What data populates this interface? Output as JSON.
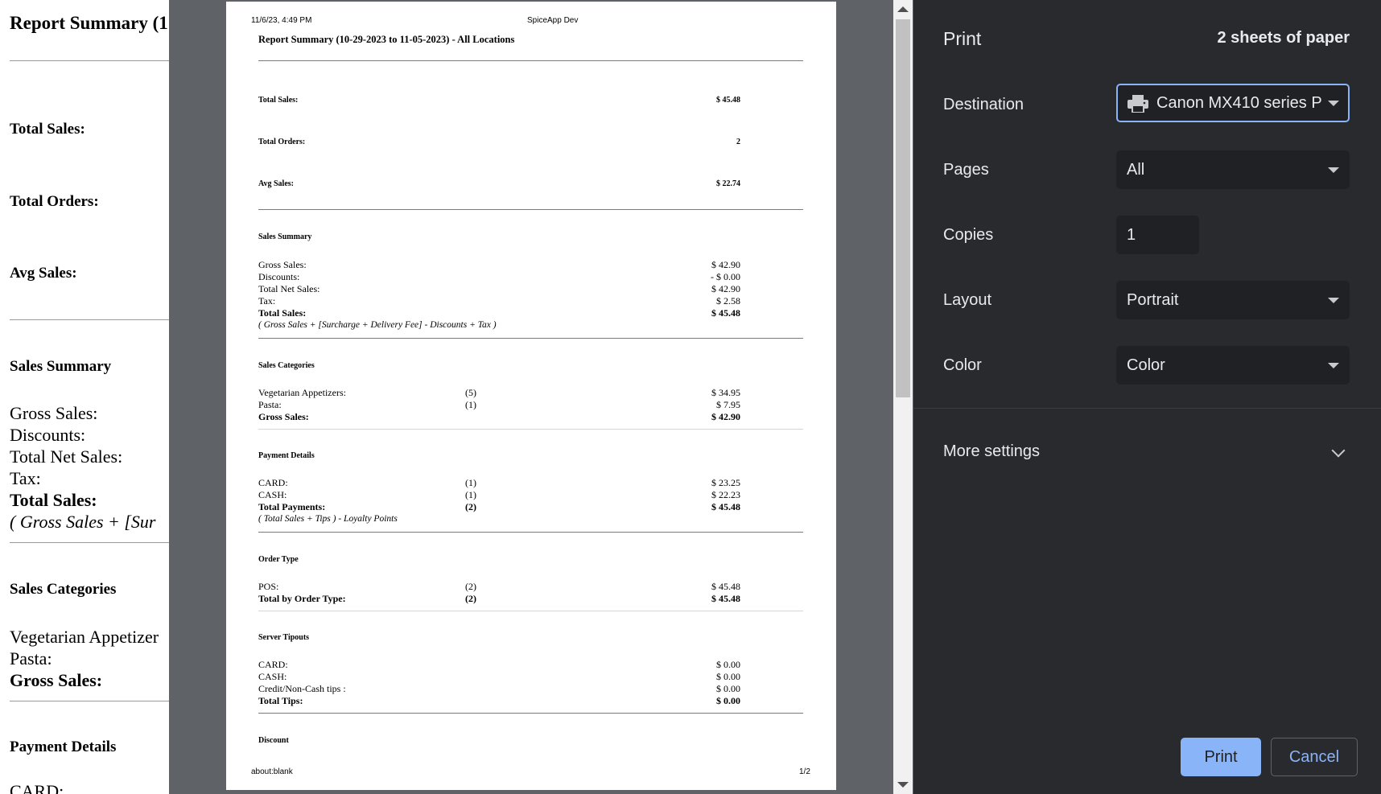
{
  "background_page": {
    "title": "Report Summary (1",
    "total_sales_label": "Total Sales:",
    "total_orders_label": "Total Orders:",
    "avg_sales_label": "Avg Sales:",
    "sales_summary_heading": "Sales Summary",
    "gross_sales": "Gross Sales:",
    "discounts": "Discounts:",
    "total_net_sales": "Total Net Sales:",
    "tax": "Tax:",
    "total_sales": "Total Sales:",
    "formula": "( Gross Sales + [Sur",
    "sales_categories_heading": "Sales Categories",
    "veg_appetizers": "Vegetarian Appetizer",
    "pasta": "Pasta:",
    "gross_sales_bold": "Gross Sales:",
    "payment_details_heading": "Payment Details",
    "card": "CARD:"
  },
  "preview": {
    "header_date": "11/6/23, 4:49 PM",
    "header_app": "SpiceApp Dev",
    "title": "Report Summary (10-29-2023 to 11-05-2023) - All Locations",
    "totals": [
      {
        "label": "Total Sales:",
        "value": "$ 45.48"
      },
      {
        "label": "Total Orders:",
        "value": "2"
      },
      {
        "label": "Avg Sales:",
        "value": "$ 22.74"
      }
    ],
    "sales_summary": {
      "heading": "Sales Summary",
      "rows": [
        {
          "label": "Gross Sales:",
          "value": "$ 42.90"
        },
        {
          "label": "Discounts:",
          "value": "- $ 0.00"
        },
        {
          "label": "Total Net Sales:",
          "value": "$ 42.90"
        },
        {
          "label": "Tax:",
          "value": "$ 2.58"
        },
        {
          "label": "Total Sales:",
          "value": "$ 45.48"
        }
      ],
      "note": "( Gross Sales + [Surcharge + Delivery Fee] - Discounts + Tax )"
    },
    "sales_categories": {
      "heading": "Sales Categories",
      "rows": [
        {
          "label": "Vegetarian Appetizers:",
          "count": "(5)",
          "value": "$ 34.95"
        },
        {
          "label": "Pasta:",
          "count": "(1)",
          "value": "$ 7.95"
        },
        {
          "label": "Gross Sales:",
          "count": "",
          "value": "$ 42.90"
        }
      ]
    },
    "payment_details": {
      "heading": "Payment Details",
      "rows": [
        {
          "label": "CARD:",
          "count": "(1)",
          "value": "$ 23.25"
        },
        {
          "label": "CASH:",
          "count": "(1)",
          "value": "$ 22.23"
        },
        {
          "label": "Total Payments:",
          "count": "(2)",
          "value": "$ 45.48"
        }
      ],
      "note": "( Total Sales + Tips ) - Loyalty Points"
    },
    "order_type": {
      "heading": "Order Type",
      "rows": [
        {
          "label": "POS:",
          "count": "(2)",
          "value": "$ 45.48"
        },
        {
          "label": "Total by Order Type:",
          "count": "(2)",
          "value": "$ 45.48"
        }
      ]
    },
    "server_tipouts": {
      "heading": "Server Tipouts",
      "rows": [
        {
          "label": "CARD:",
          "value": "$ 0.00"
        },
        {
          "label": "CASH:",
          "value": "$ 0.00"
        },
        {
          "label": "Credit/Non-Cash tips :",
          "value": "$ 0.00"
        },
        {
          "label": "Total Tips:",
          "value": "$ 0.00"
        }
      ]
    },
    "discount_heading": "Discount",
    "footer_url": "about:blank",
    "footer_page": "1/2"
  },
  "print_panel": {
    "title": "Print",
    "sheets": "2 sheets of paper",
    "destination_label": "Destination",
    "destination_value": "Canon MX410 series P",
    "pages_label": "Pages",
    "pages_value": "All",
    "copies_label": "Copies",
    "copies_value": "1",
    "layout_label": "Layout",
    "layout_value": "Portrait",
    "color_label": "Color",
    "color_value": "Color",
    "more_settings": "More settings",
    "print_button": "Print",
    "cancel_button": "Cancel",
    "accent_color": "#8ab4f8",
    "panel_bg": "#292a2d"
  }
}
